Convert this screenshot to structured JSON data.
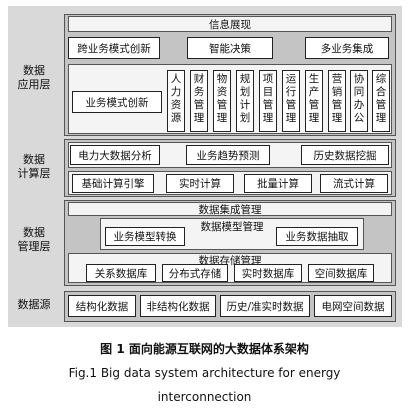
{
  "layers": {
    "application": "数据\n应用层",
    "computing": "数据\n计算层",
    "management": "数据\n管理层",
    "source": "数据源"
  },
  "application": {
    "top_bar": "信息展现",
    "row1": [
      "跨业务模式创新",
      "智能决策",
      "多业务集成"
    ],
    "left_box": "业务模式创新",
    "vertical_boxes": [
      "人力资源",
      "财务管理",
      "物资管理",
      "规划计划",
      "项目管理",
      "运行管理",
      "生产管理",
      "营销管理",
      "协同办公",
      "综合管理"
    ]
  },
  "computing": {
    "row1": [
      "电力大数据分析",
      "业务趋势预测",
      "历史数据挖掘"
    ],
    "row2": [
      "基础计算引擎",
      "实时计算",
      "批量计算",
      "流式计算"
    ]
  },
  "management": {
    "integration": "数据集成管理",
    "model_mgmt": "数据模型管理",
    "model_convert": "业务模型转换",
    "data_extract": "业务数据抽取",
    "storage_mgmt": "数据存储管理",
    "storage_row": [
      "关系数据库",
      "分布式存储",
      "实时数据库",
      "空间数据库"
    ]
  },
  "source": {
    "items": [
      "结构化数据",
      "非结构化数据",
      "历史/准实时数据",
      "电网空间数据"
    ]
  },
  "caption": {
    "cn": "图 1  面向能源互联网的大数据体系架构",
    "en_line1": "Fig.1  Big data system architecture for energy",
    "en_line2": "interconnection"
  }
}
